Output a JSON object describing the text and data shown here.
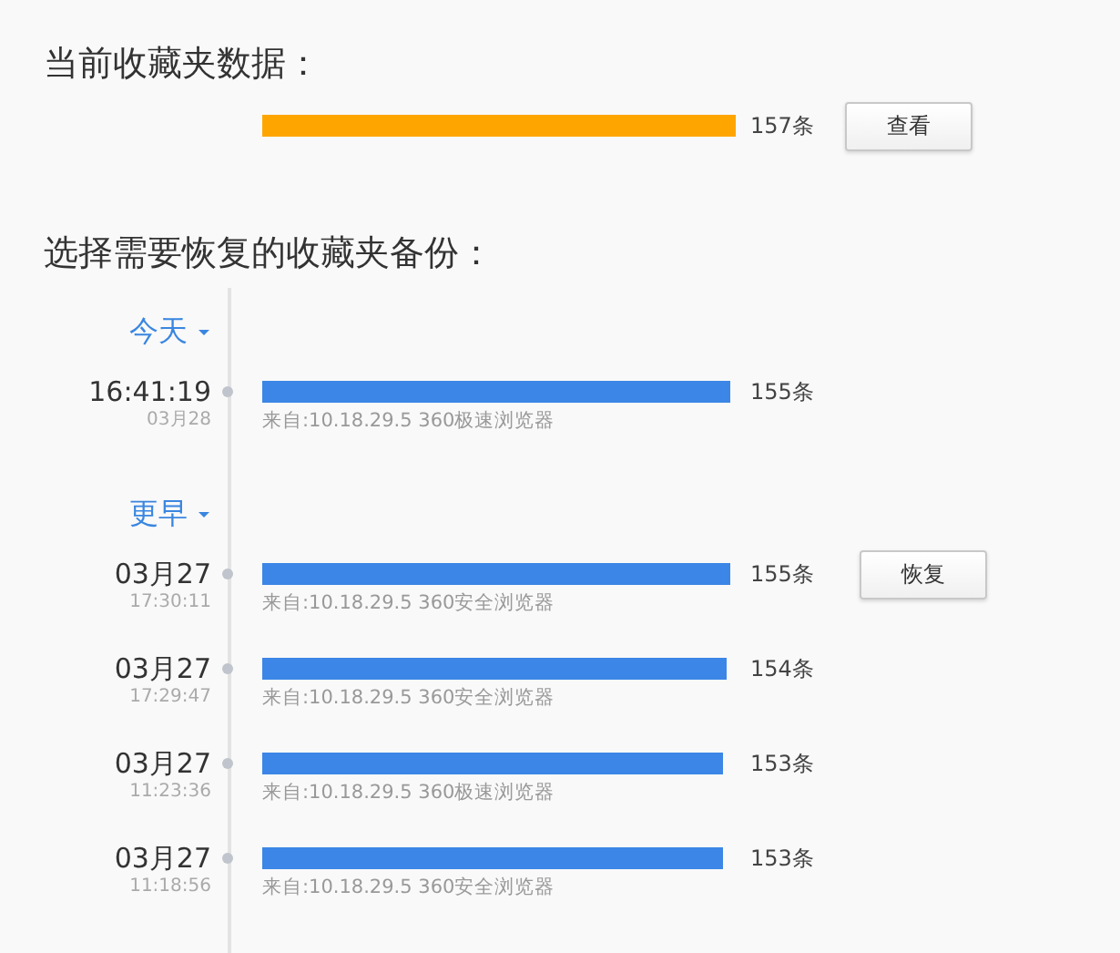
{
  "current": {
    "title": "当前收藏夹数据：",
    "count": "157条",
    "button": "查看"
  },
  "backups_title": "选择需要恢复的收藏夹备份：",
  "groups": [
    {
      "label": "今天",
      "expanded": true,
      "entries": [
        {
          "primary": "16:41:19",
          "secondary": "03月28",
          "count": "155条",
          "source": "来自:10.18.29.5 360极速浏览器"
        }
      ]
    },
    {
      "label": "更早",
      "expanded": true,
      "entries": [
        {
          "primary": "03月27",
          "secondary": "17:30:11",
          "count": "155条",
          "source": "来自:10.18.29.5 360安全浏览器",
          "button": "恢复"
        },
        {
          "primary": "03月27",
          "secondary": "17:29:47",
          "count": "154条",
          "source": "来自:10.18.29.5 360安全浏览器"
        },
        {
          "primary": "03月27",
          "secondary": "11:23:36",
          "count": "153条",
          "source": "来自:10.18.29.5 360极速浏览器"
        },
        {
          "primary": "03月27",
          "secondary": "11:18:56",
          "count": "153条",
          "source": "来自:10.18.29.5 360安全浏览器"
        }
      ]
    }
  ]
}
